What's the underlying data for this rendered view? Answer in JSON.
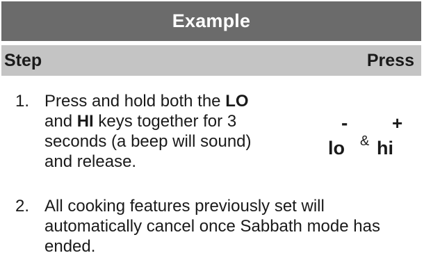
{
  "title": "Example",
  "header": {
    "step_label": "Step",
    "press_label": "Press"
  },
  "steps": [
    {
      "number": "1.",
      "lines": [
        {
          "a": "Press and hold both the ",
          "key": "LO"
        },
        {
          "a": "and ",
          "key": "HI",
          "b": " keys together for 3"
        },
        {
          "a": "seconds (a beep will sound)"
        },
        {
          "a": "and release."
        }
      ]
    },
    {
      "number": "2.",
      "lines": [
        {
          "a": "All cooking features previously set will"
        },
        {
          "a": "automatically cancel once Sabbath mode has"
        },
        {
          "a": "ended."
        }
      ]
    }
  ],
  "press": {
    "minus": "-",
    "plus": "+",
    "lo": "lo",
    "amp": "&",
    "hi": "hi"
  },
  "colors": {
    "title_bg": "#6b6b6b",
    "header_bg": "#c4c4c4",
    "text": "#1a1a1a"
  }
}
